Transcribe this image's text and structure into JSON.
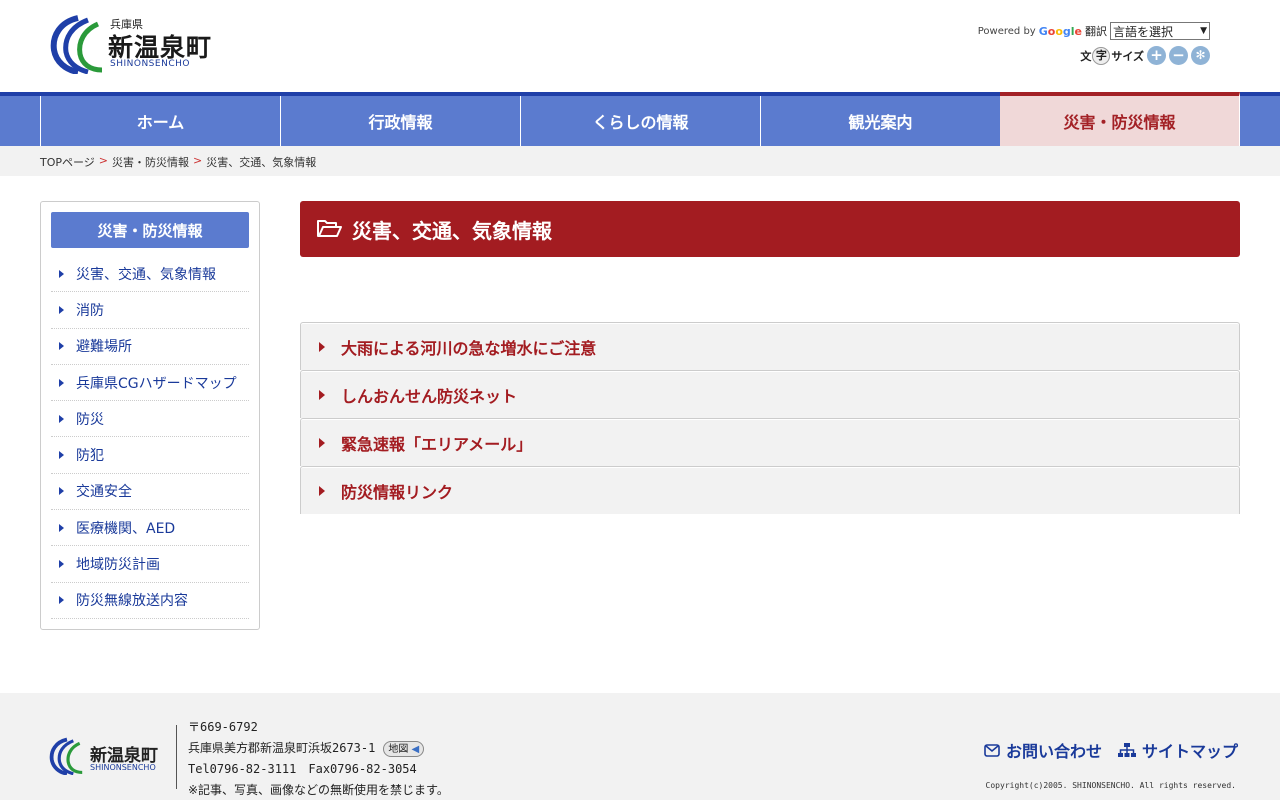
{
  "header": {
    "logo": {
      "prefecture": "兵庫県",
      "name": "新温泉町",
      "roman": "SHINONSENCHO"
    },
    "translate": {
      "powered_by": "Powered by",
      "google": "Google",
      "label": "翻訳",
      "select_value": "言語を選択"
    },
    "font_size": {
      "label_pre": "文",
      "label_ji": "字",
      "label_post": "サイズ",
      "increase": "+",
      "decrease": "−",
      "reset": "✻"
    }
  },
  "nav": {
    "items": [
      {
        "label": "ホーム"
      },
      {
        "label": "行政情報"
      },
      {
        "label": "くらしの情報"
      },
      {
        "label": "観光案内"
      },
      {
        "label": "災害・防災情報"
      }
    ]
  },
  "breadcrumb": {
    "items": [
      "TOPページ",
      "災害・防災情報",
      "災害、交通、気象情報"
    ],
    "separator": ">"
  },
  "sidebar": {
    "title": "災害・防災情報",
    "items": [
      {
        "label": "災害、交通、気象情報"
      },
      {
        "label": "消防"
      },
      {
        "label": "避難場所"
      },
      {
        "label": "兵庫県CGハザードマップ"
      },
      {
        "label": "防災"
      },
      {
        "label": "防犯"
      },
      {
        "label": "交通安全"
      },
      {
        "label": "医療機関、AED"
      },
      {
        "label": "地域防災計画"
      },
      {
        "label": "防災無線放送内容"
      }
    ]
  },
  "main": {
    "title": "災害、交通、気象情報",
    "accordion": [
      {
        "label": "大雨による河川の急な増水にご注意"
      },
      {
        "label": "しんおんせん防災ネット"
      },
      {
        "label": "緊急速報「エリアメール」"
      },
      {
        "label": "防災情報リンク"
      }
    ]
  },
  "footer": {
    "logo": {
      "name": "新温泉町",
      "roman": "SHINONSENCHO"
    },
    "postal": "〒669-6792",
    "address": "兵庫県美方郡新温泉町浜坂2673-1",
    "map_button": "地図",
    "phone": "Tel0796-82-3111　Fax0796-82-3054",
    "notice": "※記事、写真、画像などの無断使用を禁じます。",
    "links": {
      "contact": "お問い合わせ",
      "sitemap": "サイトマップ"
    },
    "copyright": "Copyright(c)2005. SHINONSENCHO. All rights reserved."
  },
  "colors": {
    "nav_blue": "#5b7bcf",
    "nav_border": "#1f3fa8",
    "accent_red": "#a31c21",
    "active_tab_bg": "#f0d8d8"
  }
}
